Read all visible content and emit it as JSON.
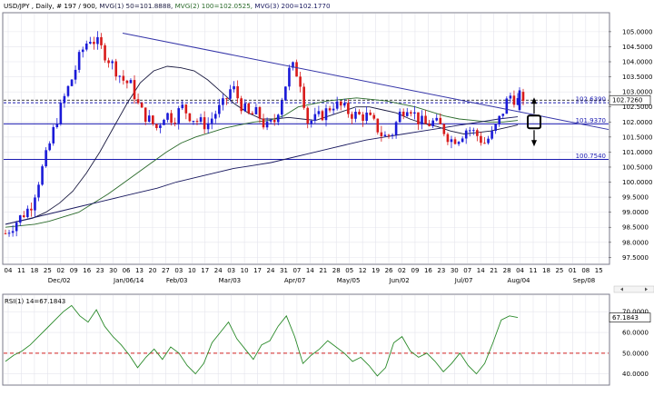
{
  "header": {
    "symbol": "USD/JPY , Daily, # 197 / 900,",
    "ma1": "MVG(1) 50=101.8888,",
    "ma2": "MVG(2) 100=102.0525,",
    "ma3": "MVG(3) 200=102.1770"
  },
  "colors": {
    "bull": "#1a1ad8",
    "bear": "#d81a1a",
    "trendline": "#3434a8",
    "hline": "#1a1ab0",
    "ma_fast": "#1a1a40",
    "ma_mid": "#2a6a2a",
    "ma_slow": "#1a1a60",
    "rsi": "#2a8a2a",
    "rsi_mid": "#d02020",
    "grid": "#e4e4ec",
    "arrow": "#000000"
  },
  "price_panel": {
    "ylim": [
      97.3,
      105.6
    ],
    "y_ticks": [
      "105.0000",
      "104.5000",
      "104.0000",
      "103.5000",
      "103.0000",
      "102.5000",
      "102.0000",
      "101.5000",
      "101.0000",
      "100.5000",
      "100.0000",
      "99.5000",
      "99.0000",
      "98.5000",
      "98.0000",
      "97.5000"
    ],
    "y_tick_values": [
      105.0,
      104.5,
      104.0,
      103.5,
      103.0,
      102.5,
      102.0,
      101.5,
      101.0,
      100.5,
      100.0,
      99.5,
      99.0,
      98.5,
      98.0,
      97.5
    ],
    "hlines": [
      {
        "value": 102.639,
        "label": "102.6390",
        "style": "dashed"
      },
      {
        "value": 101.937,
        "label": "101.9370",
        "style": "solid"
      },
      {
        "value": 100.754,
        "label": "100.7540",
        "style": "solid"
      }
    ],
    "current_price_label": "102.7260",
    "current_price_value": 102.726
  },
  "x_axis": {
    "day_ticks": [
      "04",
      "11",
      "18",
      "25",
      "02",
      "09",
      "16",
      "23",
      "30",
      "06",
      "13",
      "20",
      "27",
      "03",
      "10",
      "17",
      "24",
      "03",
      "10",
      "17",
      "24",
      "31",
      "07",
      "14",
      "21",
      "28",
      "05",
      "12",
      "19",
      "26",
      "02",
      "09",
      "16",
      "23",
      "30",
      "07",
      "14",
      "21",
      "28",
      "04",
      "11",
      "18",
      "25",
      "01",
      "08",
      "15"
    ],
    "month_labels": [
      {
        "text": "Dec/02",
        "at": 4
      },
      {
        "text": "Jan/06/14",
        "at": 9
      },
      {
        "text": "Feb/03",
        "at": 13
      },
      {
        "text": "Mar/03",
        "at": 17
      },
      {
        "text": "Apr/07",
        "at": 22
      },
      {
        "text": "May/05",
        "at": 26
      },
      {
        "text": "Jun/02",
        "at": 30
      },
      {
        "text": "Jul/07",
        "at": 35
      },
      {
        "text": "Aug/04",
        "at": 39
      },
      {
        "text": "Sep/08",
        "at": 44
      }
    ]
  },
  "rsi_panel": {
    "label": "RSI(1) 14=67.1843",
    "current_label": "67.1843",
    "current_value": 67.1843,
    "ylim": [
      35,
      78
    ],
    "y_ticks": [
      "70.0000",
      "60.0000",
      "50.0000",
      "40.0000"
    ],
    "y_tick_values": [
      70,
      60,
      50,
      40
    ],
    "midline": 50
  },
  "chart_data": {
    "type": "candlestick",
    "title": "USD/JPY , Daily, # 197 / 900,",
    "xlabel": "",
    "ylabel": "",
    "ylim": [
      97.3,
      105.6
    ],
    "series": [
      {
        "name": "MVG(1) 50=101.8888",
        "values": [
          98.6,
          98.7,
          98.8,
          99.0,
          99.3,
          99.7,
          100.3,
          101.0,
          101.8,
          102.6,
          103.3,
          103.7,
          103.85,
          103.8,
          103.7,
          103.4,
          103.0,
          102.6,
          102.3,
          102.1,
          102.1,
          102.15,
          102.1,
          102.05,
          102.2,
          102.35,
          102.5,
          102.5,
          102.4,
          102.3,
          102.1,
          101.95,
          101.85,
          101.7,
          101.6,
          101.65,
          101.7,
          101.8,
          101.9
        ]
      },
      {
        "name": "MVG(2) 100=102.0525",
        "values": [
          98.5,
          98.55,
          98.6,
          98.7,
          98.85,
          99.0,
          99.3,
          99.6,
          99.95,
          100.3,
          100.65,
          101.0,
          101.3,
          101.5,
          101.65,
          101.8,
          101.9,
          102.0,
          102.05,
          102.2,
          102.5,
          102.6,
          102.7,
          102.75,
          102.8,
          102.75,
          102.7,
          102.6,
          102.5,
          102.35,
          102.2,
          102.1,
          102.05,
          102.0,
          102.0,
          102.05
        ]
      },
      {
        "name": "MVG(3) 200=102.1770",
        "values": [
          98.6,
          98.75,
          98.9,
          99.05,
          99.2,
          99.35,
          99.5,
          99.65,
          99.8,
          100.0,
          100.15,
          100.3,
          100.45,
          100.55,
          100.65,
          100.8,
          100.95,
          101.1,
          101.25,
          101.4,
          101.5,
          101.6,
          101.7,
          101.8,
          101.9,
          102.0,
          102.1,
          102.17
        ]
      }
    ],
    "candles": {
      "close_path": [
        98.3,
        98.6,
        98.9,
        99.2,
        100.1,
        101.0,
        102.0,
        102.8,
        103.5,
        104.3,
        104.8,
        104.6,
        104.2,
        103.8,
        103.4,
        103.2,
        102.4,
        102.1,
        101.8,
        102.3,
        102.1,
        102.5,
        102.2,
        102.0,
        101.9,
        102.3,
        102.6,
        103.2,
        102.6,
        102.2,
        102.3,
        101.8,
        102.0,
        102.9,
        103.9,
        103.5,
        102.0,
        102.1,
        102.3,
        102.6,
        102.5,
        102.3,
        102.2,
        102.2,
        101.9,
        101.5,
        101.6,
        102.3,
        102.6,
        102.1,
        101.9,
        102.0,
        101.8,
        101.4,
        101.5,
        101.8,
        101.6,
        101.3,
        101.6,
        102.2,
        102.9,
        102.7
      ],
      "trendline": {
        "from_value": 104.95,
        "to_value": 102.05
      },
      "last_high": 103.15,
      "last_low": 102.35
    },
    "rsi_values": [
      46,
      49,
      51,
      54,
      58,
      62,
      66,
      70,
      73,
      68,
      65,
      71,
      63,
      58,
      54,
      49,
      43,
      48,
      52,
      47,
      53,
      50,
      44,
      40,
      45,
      55,
      60,
      65,
      57,
      52,
      47,
      54,
      56,
      63,
      68,
      58,
      45,
      49,
      52,
      56,
      53,
      50,
      46,
      48,
      44,
      39,
      43,
      55,
      58,
      51,
      48,
      50,
      46,
      41,
      45,
      50,
      44,
      40,
      45,
      55,
      66,
      68,
      67.2
    ],
    "legend": [
      "MVG(1) 50=101.8888",
      "MVG(2) 100=102.0525",
      "MVG(3) 200=102.1770"
    ]
  }
}
